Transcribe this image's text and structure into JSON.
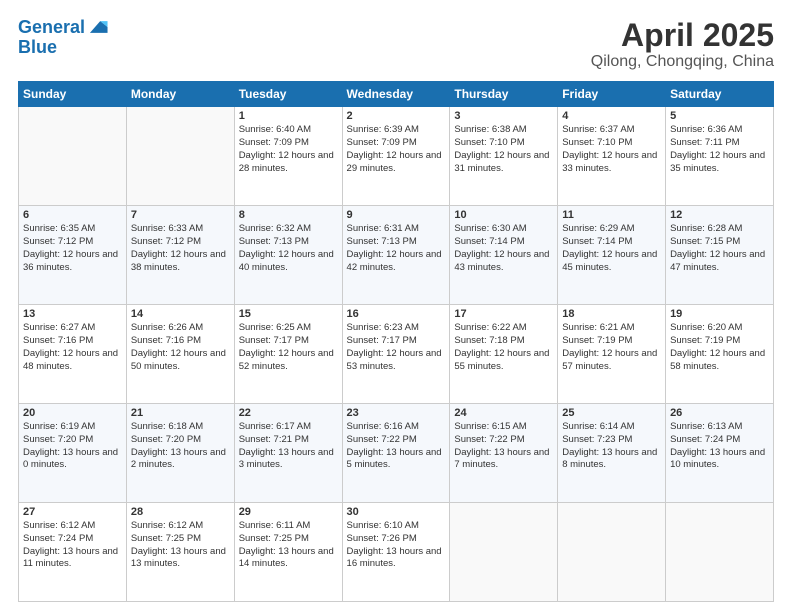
{
  "header": {
    "logo_line1": "General",
    "logo_line2": "Blue",
    "title": "April 2025",
    "subtitle": "Qilong, Chongqing, China"
  },
  "calendar": {
    "days": [
      "Sunday",
      "Monday",
      "Tuesday",
      "Wednesday",
      "Thursday",
      "Friday",
      "Saturday"
    ],
    "weeks": [
      [
        {
          "num": "",
          "info": ""
        },
        {
          "num": "",
          "info": ""
        },
        {
          "num": "1",
          "info": "Sunrise: 6:40 AM\nSunset: 7:09 PM\nDaylight: 12 hours and 28 minutes."
        },
        {
          "num": "2",
          "info": "Sunrise: 6:39 AM\nSunset: 7:09 PM\nDaylight: 12 hours and 29 minutes."
        },
        {
          "num": "3",
          "info": "Sunrise: 6:38 AM\nSunset: 7:10 PM\nDaylight: 12 hours and 31 minutes."
        },
        {
          "num": "4",
          "info": "Sunrise: 6:37 AM\nSunset: 7:10 PM\nDaylight: 12 hours and 33 minutes."
        },
        {
          "num": "5",
          "info": "Sunrise: 6:36 AM\nSunset: 7:11 PM\nDaylight: 12 hours and 35 minutes."
        }
      ],
      [
        {
          "num": "6",
          "info": "Sunrise: 6:35 AM\nSunset: 7:12 PM\nDaylight: 12 hours and 36 minutes."
        },
        {
          "num": "7",
          "info": "Sunrise: 6:33 AM\nSunset: 7:12 PM\nDaylight: 12 hours and 38 minutes."
        },
        {
          "num": "8",
          "info": "Sunrise: 6:32 AM\nSunset: 7:13 PM\nDaylight: 12 hours and 40 minutes."
        },
        {
          "num": "9",
          "info": "Sunrise: 6:31 AM\nSunset: 7:13 PM\nDaylight: 12 hours and 42 minutes."
        },
        {
          "num": "10",
          "info": "Sunrise: 6:30 AM\nSunset: 7:14 PM\nDaylight: 12 hours and 43 minutes."
        },
        {
          "num": "11",
          "info": "Sunrise: 6:29 AM\nSunset: 7:14 PM\nDaylight: 12 hours and 45 minutes."
        },
        {
          "num": "12",
          "info": "Sunrise: 6:28 AM\nSunset: 7:15 PM\nDaylight: 12 hours and 47 minutes."
        }
      ],
      [
        {
          "num": "13",
          "info": "Sunrise: 6:27 AM\nSunset: 7:16 PM\nDaylight: 12 hours and 48 minutes."
        },
        {
          "num": "14",
          "info": "Sunrise: 6:26 AM\nSunset: 7:16 PM\nDaylight: 12 hours and 50 minutes."
        },
        {
          "num": "15",
          "info": "Sunrise: 6:25 AM\nSunset: 7:17 PM\nDaylight: 12 hours and 52 minutes."
        },
        {
          "num": "16",
          "info": "Sunrise: 6:23 AM\nSunset: 7:17 PM\nDaylight: 12 hours and 53 minutes."
        },
        {
          "num": "17",
          "info": "Sunrise: 6:22 AM\nSunset: 7:18 PM\nDaylight: 12 hours and 55 minutes."
        },
        {
          "num": "18",
          "info": "Sunrise: 6:21 AM\nSunset: 7:19 PM\nDaylight: 12 hours and 57 minutes."
        },
        {
          "num": "19",
          "info": "Sunrise: 6:20 AM\nSunset: 7:19 PM\nDaylight: 12 hours and 58 minutes."
        }
      ],
      [
        {
          "num": "20",
          "info": "Sunrise: 6:19 AM\nSunset: 7:20 PM\nDaylight: 13 hours and 0 minutes."
        },
        {
          "num": "21",
          "info": "Sunrise: 6:18 AM\nSunset: 7:20 PM\nDaylight: 13 hours and 2 minutes."
        },
        {
          "num": "22",
          "info": "Sunrise: 6:17 AM\nSunset: 7:21 PM\nDaylight: 13 hours and 3 minutes."
        },
        {
          "num": "23",
          "info": "Sunrise: 6:16 AM\nSunset: 7:22 PM\nDaylight: 13 hours and 5 minutes."
        },
        {
          "num": "24",
          "info": "Sunrise: 6:15 AM\nSunset: 7:22 PM\nDaylight: 13 hours and 7 minutes."
        },
        {
          "num": "25",
          "info": "Sunrise: 6:14 AM\nSunset: 7:23 PM\nDaylight: 13 hours and 8 minutes."
        },
        {
          "num": "26",
          "info": "Sunrise: 6:13 AM\nSunset: 7:24 PM\nDaylight: 13 hours and 10 minutes."
        }
      ],
      [
        {
          "num": "27",
          "info": "Sunrise: 6:12 AM\nSunset: 7:24 PM\nDaylight: 13 hours and 11 minutes."
        },
        {
          "num": "28",
          "info": "Sunrise: 6:12 AM\nSunset: 7:25 PM\nDaylight: 13 hours and 13 minutes."
        },
        {
          "num": "29",
          "info": "Sunrise: 6:11 AM\nSunset: 7:25 PM\nDaylight: 13 hours and 14 minutes."
        },
        {
          "num": "30",
          "info": "Sunrise: 6:10 AM\nSunset: 7:26 PM\nDaylight: 13 hours and 16 minutes."
        },
        {
          "num": "",
          "info": ""
        },
        {
          "num": "",
          "info": ""
        },
        {
          "num": "",
          "info": ""
        }
      ]
    ]
  }
}
